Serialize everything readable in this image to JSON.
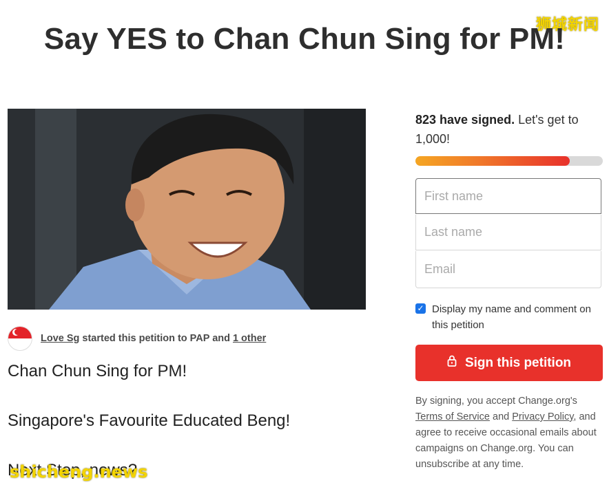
{
  "watermarks": {
    "top": "狮城新闻",
    "bottom": "shicheng.news"
  },
  "page_title": "Say YES to Chan Chun Sing for PM!",
  "starter": {
    "name": "Love Sg",
    "middle": "started this petition to PAP and",
    "other": "1 other"
  },
  "body": {
    "line1": "Chan Chun Sing for PM!",
    "line2": "Singapore's Favourite Educated Beng!",
    "line3": "Next Step, news?"
  },
  "signatures": {
    "count_text": "823 have signed.",
    "goal_text": "Let's get to 1,000!",
    "progress_fraction": 0.823
  },
  "form": {
    "first_name_placeholder": "First name",
    "last_name_placeholder": "Last name",
    "email_placeholder": "Email",
    "display_checkbox_label": "Display my name and comment on this petition",
    "display_checked": true,
    "sign_button_label": "Sign this petition"
  },
  "legal": {
    "prefix": "By signing, you accept Change.org's",
    "terms": "Terms of Service",
    "and": "and",
    "privacy": "Privacy Policy",
    "suffix": ", and agree to receive occasional emails about campaigns on Change.org. You can unsubscribe at any time."
  },
  "colors": {
    "accent": "#e8312b",
    "progress_start": "#f5a623",
    "checkbox": "#1a73e8"
  }
}
